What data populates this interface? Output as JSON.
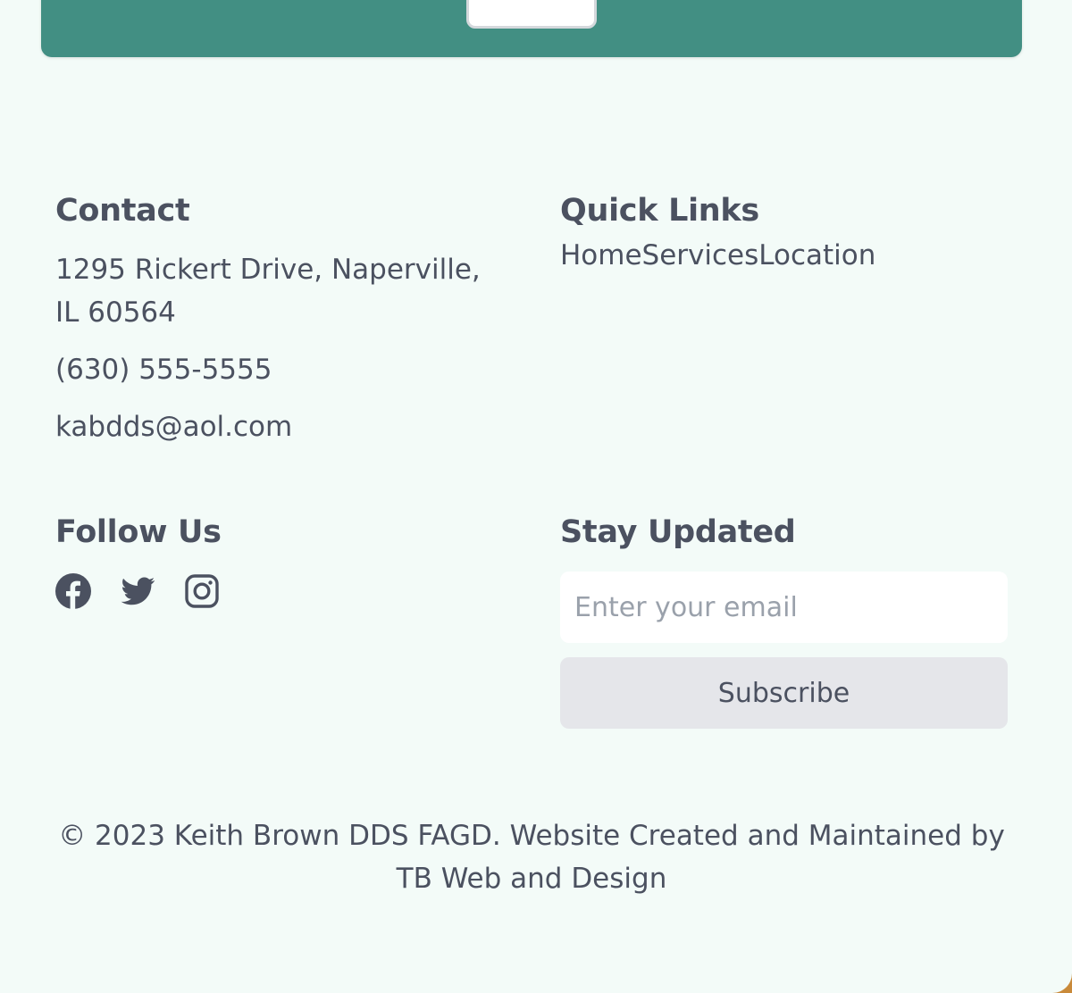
{
  "contact": {
    "heading": "Contact",
    "address": "1295 Rickert Drive, Naperville, IL 60564",
    "phone": "(630) 555-5555",
    "email": "kabdds@aol.com"
  },
  "quick_links": {
    "heading": "Quick Links",
    "items": [
      {
        "label": "Home"
      },
      {
        "label": "Services"
      },
      {
        "label": "Location"
      }
    ]
  },
  "follow": {
    "heading": "Follow Us",
    "icons": [
      "facebook-icon",
      "twitter-icon",
      "instagram-icon"
    ]
  },
  "newsletter": {
    "heading": "Stay Updated",
    "placeholder": "Enter your email",
    "button_label": "Subscribe"
  },
  "copyright": "© 2023 Keith Brown DDS FAGD. Website Created and Maintained by TB Web and Design",
  "colors": {
    "brand_green": "#428f83",
    "page_background": "#f3fbf8",
    "text": "#4b5160",
    "button_background": "#e5e6ea"
  }
}
